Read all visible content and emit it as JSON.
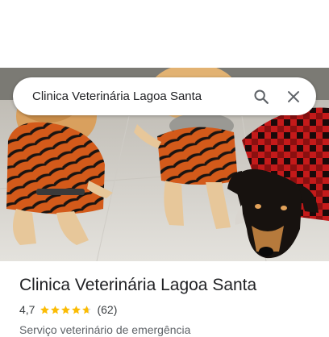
{
  "search": {
    "query": "Clinica Veterinária Lagoa Santa",
    "search_icon": "search-icon",
    "close_icon": "close-icon"
  },
  "photo": {
    "subject": "dogs"
  },
  "place": {
    "name": "Clinica Veterinária Lagoa Santa",
    "rating": "4,7",
    "rating_value": 4.7,
    "rating_max": 5,
    "reviews": "(62)",
    "category": "Serviço veterinário de emergência"
  },
  "colors": {
    "star": "#fbbc04",
    "star_empty": "#dadce0",
    "text_primary": "#202124",
    "text_secondary": "#5f6368"
  }
}
